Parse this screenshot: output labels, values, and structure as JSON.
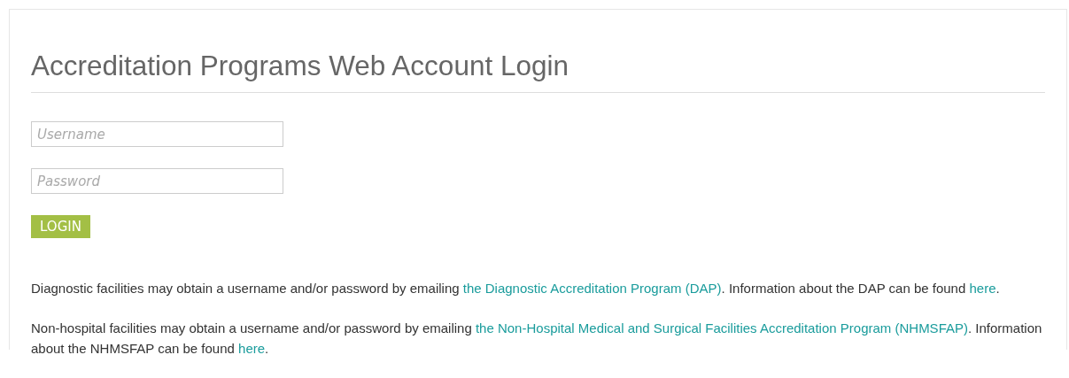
{
  "title": "Accreditation Programs Web Account Login",
  "fields": [
    {
      "placeholder": "Username"
    },
    {
      "placeholder": "Password"
    }
  ],
  "button": "LOGIN",
  "paragraphs": [
    [
      {
        "kind": "text",
        "text": "Diagnostic facilities may obtain a username and/or password by emailing "
      },
      {
        "kind": "link",
        "text": "the Diagnostic Accreditation Program (DAP)"
      },
      {
        "kind": "text",
        "text": ". Information about the DAP can be found "
      },
      {
        "kind": "link",
        "text": "here"
      },
      {
        "kind": "text",
        "text": "."
      }
    ],
    [
      {
        "kind": "text",
        "text": "Non-hospital facilities may obtain a username and/or password by emailing "
      },
      {
        "kind": "link",
        "text": "the Non-Hospital Medical and Surgical Facilities Accreditation Program (NHMSFAP)"
      },
      {
        "kind": "text",
        "text": ". Information about the NHMSFAP can be found "
      },
      {
        "kind": "link",
        "text": "here"
      },
      {
        "kind": "text",
        "text": "."
      }
    ]
  ]
}
